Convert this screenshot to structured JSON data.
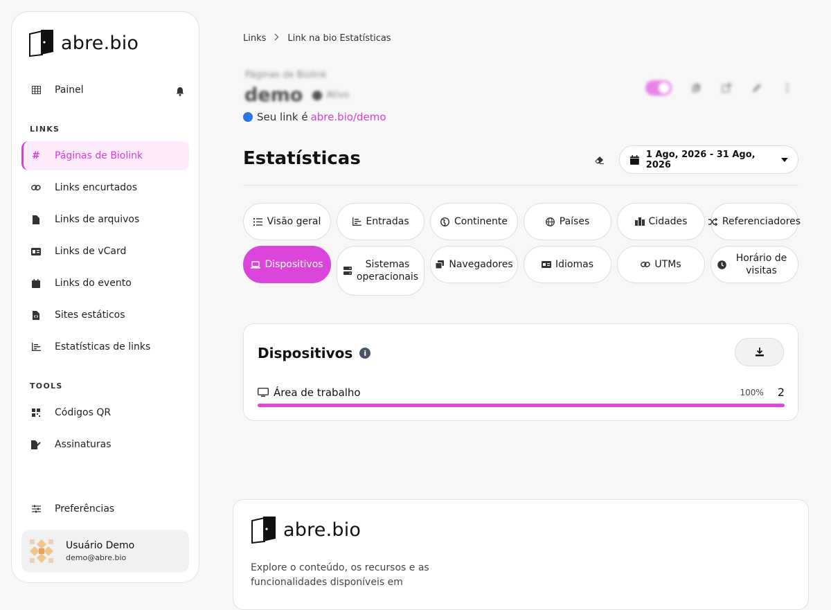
{
  "brand": {
    "name": "abre.bio"
  },
  "sidebar": {
    "top_item": {
      "label": "Painel",
      "icon": "table-icon"
    },
    "sections": [
      {
        "label": "LINKS"
      },
      {
        "label": "TOOLS"
      }
    ],
    "links_items": [
      {
        "label": "Páginas de Biolink",
        "icon": "hash-icon",
        "active": true
      },
      {
        "label": "Links encurtados",
        "icon": "link-icon"
      },
      {
        "label": "Links de arquivos",
        "icon": "file-icon"
      },
      {
        "label": "Links de vCard",
        "icon": "id-card-icon"
      },
      {
        "label": "Links do evento",
        "icon": "calendar-icon"
      },
      {
        "label": "Sites estáticos",
        "icon": "file-code-icon"
      },
      {
        "label": "Estatísticas de links",
        "icon": "chart-bar-icon"
      }
    ],
    "tools_items": [
      {
        "label": "Códigos QR",
        "icon": "qrcode-icon"
      },
      {
        "label": "Assinaturas",
        "icon": "signature-icon"
      }
    ],
    "preferences": {
      "label": "Preferências",
      "icon": "sliders-icon"
    },
    "user": {
      "name": "Usuário Demo",
      "email": "demo@abre.bio"
    }
  },
  "breadcrumb": {
    "items": [
      "Links",
      "Link na bio Estatísticas"
    ]
  },
  "biolink": {
    "label": "Páginas de Biolink",
    "name": "demo",
    "status": "Ativo",
    "your_link_prefix": "Seu link é",
    "url": "abre.bio/demo"
  },
  "stats": {
    "title": "Estatísticas",
    "date_range": "1 Ago, 2026 - 31 Ago, 2026"
  },
  "tabs": [
    {
      "label": "Visão geral",
      "icon": "list-icon"
    },
    {
      "label": "Entradas",
      "icon": "chart-line-icon"
    },
    {
      "label": "Continente",
      "icon": "globe-europe-icon"
    },
    {
      "label": "Países",
      "icon": "globe-icon"
    },
    {
      "label": "Cidades",
      "icon": "city-icon"
    },
    {
      "label": "Referenciadores",
      "icon": "random-icon"
    },
    {
      "label": "Dispositivos",
      "icon": "laptop-icon",
      "active": true
    },
    {
      "label": "Sistemas operacionais",
      "icon": "server-icon"
    },
    {
      "label": "Navegadores",
      "icon": "window-restore-icon"
    },
    {
      "label": "Idiomas",
      "icon": "language-icon"
    },
    {
      "label": "UTMs",
      "icon": "link-icon"
    },
    {
      "label": "Horário de visitas",
      "icon": "clock-icon"
    }
  ],
  "devices_card": {
    "title": "Dispositivos",
    "rows": [
      {
        "label": "Área de trabalho",
        "icon": "desktop-icon",
        "percent_label": "100%",
        "percent": 100,
        "count": "2"
      }
    ]
  },
  "footer": {
    "brand": "abre.bio",
    "text": "Explore o conteúdo, os recursos e as funcionalidades disponíveis em"
  },
  "colors": {
    "accent": "#dc45dc",
    "link_dot": "#2b78e4"
  }
}
